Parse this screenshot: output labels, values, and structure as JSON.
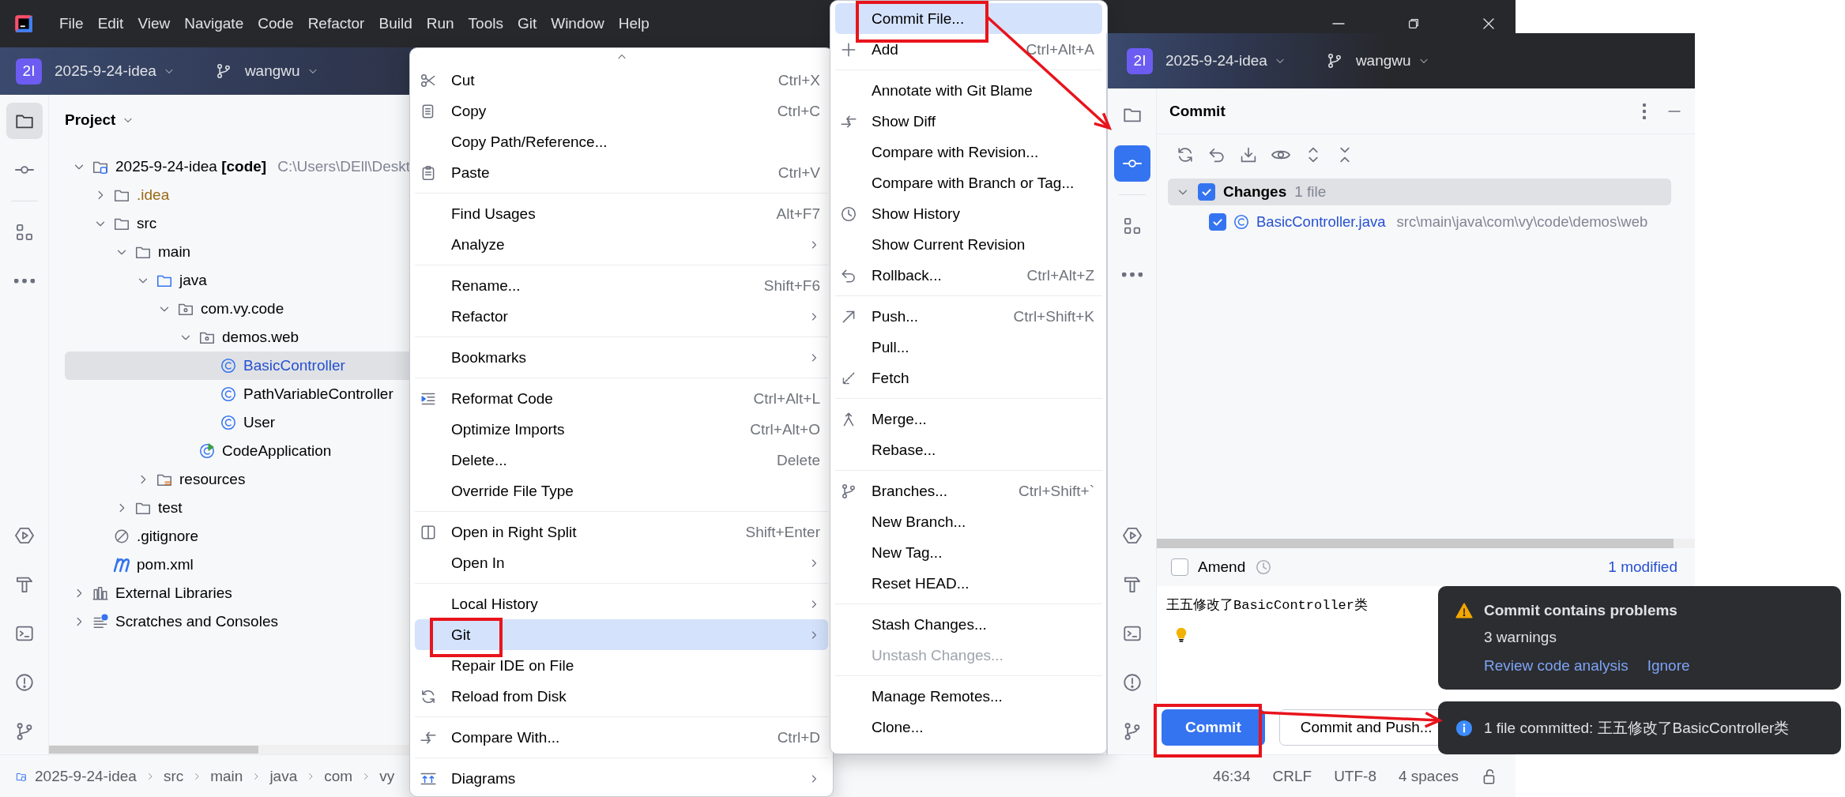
{
  "title_bar": {
    "menu": [
      "File",
      "Edit",
      "View",
      "Navigate",
      "Code",
      "Refactor",
      "Build",
      "Run",
      "Tools",
      "Git",
      "Window",
      "Help"
    ]
  },
  "toolbar": {
    "project_initials": "2I",
    "project": "2025-9-24-idea",
    "branch": "wangwu"
  },
  "left_stripe": {
    "top": [
      {
        "selected": true
      },
      {
        "selected": false
      },
      {
        "selected": false
      },
      {
        "selected": false
      }
    ],
    "bottom": [
      {
        "selected": false
      },
      {
        "selected": false
      },
      {
        "selected": false
      },
      {
        "selected": false
      },
      {
        "selected": false
      }
    ]
  },
  "project_panel": {
    "title": "Project",
    "tree": [
      {
        "label": "2025-9-24-idea **[code]**",
        "hint": "C:\\Users\\DEll\\Deskt",
        "kind": "module",
        "expanded": true,
        "selected": false,
        "children": [
          {
            "label": ".idea",
            "kind": "folder",
            "expanded": false,
            "selected": false,
            "color": "#9a6a14"
          },
          {
            "label": "src",
            "kind": "folder",
            "expanded": true,
            "selected": false,
            "children": [
              {
                "label": "main",
                "kind": "folder",
                "expanded": true,
                "selected": false,
                "children": [
                  {
                    "label": "java",
                    "kind": "source-folder",
                    "expanded": true,
                    "selected": false,
                    "children": [
                      {
                        "label": "com.vy.code",
                        "kind": "package",
                        "expanded": true,
                        "selected": false,
                        "children": [
                          {
                            "label": "demos.web",
                            "kind": "package",
                            "expanded": true,
                            "selected": false,
                            "children": [
                              {
                                "label": "BasicController",
                                "kind": "class",
                                "selected": true,
                                "color": "#2550d0"
                              },
                              {
                                "label": "PathVariableController",
                                "kind": "class",
                                "selected": false
                              },
                              {
                                "label": "User",
                                "kind": "class",
                                "selected": false
                              }
                            ]
                          },
                          {
                            "label": "CodeApplication",
                            "kind": "app-class",
                            "selected": false
                          }
                        ]
                      }
                    ]
                  },
                  {
                    "label": "resources",
                    "kind": "resources-folder",
                    "expanded": false,
                    "selected": false
                  }
                ]
              },
              {
                "label": "test",
                "kind": "folder",
                "expanded": false,
                "selected": false
              }
            ]
          },
          {
            "label": ".gitignore",
            "kind": "ignore-file",
            "selected": false
          },
          {
            "label": "pom.xml",
            "kind": "maven-file",
            "selected": false
          }
        ]
      },
      {
        "label": "External Libraries",
        "kind": "libraries",
        "expanded": false,
        "selected": false
      },
      {
        "label": "Scratches and Consoles",
        "kind": "scratches",
        "expanded": false,
        "selected": false
      }
    ]
  },
  "status_bar": {
    "breadcrumbs": [
      "2025-9-24-idea",
      "src",
      "main",
      "java",
      "com",
      "vy"
    ],
    "caret": "46:34",
    "line_separator": "CRLF",
    "encoding": "UTF-8",
    "indent": "4 spaces"
  },
  "context_menu": {
    "sections": [
      [
        {
          "label": "Cut",
          "shortcut": "Ctrl+X",
          "selected": false
        },
        {
          "label": "Copy",
          "shortcut": "Ctrl+C",
          "selected": false
        },
        {
          "label": "Copy Path/Reference...",
          "selected": false
        },
        {
          "label": "Paste",
          "shortcut": "Ctrl+V",
          "selected": false
        }
      ],
      [
        {
          "label": "Find Usages",
          "shortcut": "Alt+F7",
          "selected": false
        },
        {
          "label": "Analyze",
          "submenu": true,
          "selected": false
        }
      ],
      [
        {
          "label": "Rename...",
          "shortcut": "Shift+F6",
          "selected": false
        },
        {
          "label": "Refactor",
          "submenu": true,
          "selected": false
        }
      ],
      [
        {
          "label": "Bookmarks",
          "submenu": true,
          "selected": false
        }
      ],
      [
        {
          "label": "Reformat Code",
          "shortcut": "Ctrl+Alt+L",
          "selected": false
        },
        {
          "label": "Optimize Imports",
          "shortcut": "Ctrl+Alt+O",
          "selected": false
        },
        {
          "label": "Delete...",
          "shortcut": "Delete",
          "selected": false
        },
        {
          "label": "Override File Type",
          "selected": false
        }
      ],
      [
        {
          "label": "Open in Right Split",
          "shortcut": "Shift+Enter",
          "selected": false
        },
        {
          "label": "Open In",
          "submenu": true,
          "selected": false
        }
      ],
      [
        {
          "label": "Local History",
          "submenu": true,
          "selected": false
        },
        {
          "label": "Git",
          "submenu": true,
          "selected": true
        },
        {
          "label": "Repair IDE on File",
          "selected": false
        },
        {
          "label": "Reload from Disk",
          "selected": false
        }
      ],
      [
        {
          "label": "Compare With...",
          "shortcut": "Ctrl+D",
          "selected": false
        }
      ],
      [
        {
          "label": "Diagrams",
          "submenu": true,
          "selected": false
        }
      ]
    ]
  },
  "git_menu": {
    "sections": [
      [
        {
          "label": "Commit File...",
          "selected": true
        },
        {
          "label": "Add",
          "shortcut": "Ctrl+Alt+A",
          "selected": false
        }
      ],
      [
        {
          "label": "Annotate with Git Blame",
          "selected": false
        },
        {
          "label": "Show Diff",
          "selected": false
        },
        {
          "label": "Compare with Revision...",
          "selected": false
        },
        {
          "label": "Compare with Branch or Tag...",
          "selected": false
        },
        {
          "label": "Show History",
          "selected": false
        },
        {
          "label": "Show Current Revision",
          "selected": false
        },
        {
          "label": "Rollback...",
          "shortcut": "Ctrl+Alt+Z",
          "selected": false
        }
      ],
      [
        {
          "label": "Push...",
          "shortcut": "Ctrl+Shift+K",
          "selected": false
        },
        {
          "label": "Pull...",
          "selected": false
        },
        {
          "label": "Fetch",
          "selected": false
        }
      ],
      [
        {
          "label": "Merge...",
          "selected": false
        },
        {
          "label": "Rebase...",
          "selected": false
        }
      ],
      [
        {
          "label": "Branches...",
          "shortcut": "Ctrl+Shift+`",
          "selected": false
        },
        {
          "label": "New Branch...",
          "selected": false
        },
        {
          "label": "New Tag...",
          "selected": false
        },
        {
          "label": "Reset HEAD...",
          "selected": false
        }
      ],
      [
        {
          "label": "Stash Changes...",
          "selected": false
        },
        {
          "label": "Unstash Changes...",
          "disabled": true,
          "selected": false
        }
      ],
      [
        {
          "label": "Manage Remotes...",
          "selected": false
        },
        {
          "label": "Clone...",
          "selected": false
        }
      ]
    ]
  },
  "commit_panel": {
    "toolbar": {
      "project_initials": "2I",
      "project": "2025-9-24-idea",
      "branch": "wangwu"
    },
    "left_stripe": {
      "top": [
        {
          "selected": false
        },
        {
          "selected": true
        },
        {
          "selected": false
        },
        {
          "selected": false
        }
      ],
      "bottom": [
        {
          "selected": false
        },
        {
          "selected": false
        },
        {
          "selected": false
        },
        {
          "selected": false
        },
        {
          "selected": false
        }
      ]
    },
    "title": "Commit",
    "changes": {
      "label": "Changes",
      "count": "1 file",
      "checked": true,
      "expanded": true,
      "files": [
        {
          "name": "BasicController.java",
          "path": "src\\main\\java\\com\\vy\\code\\demos\\web",
          "checked": true
        }
      ]
    },
    "amend": {
      "label": "Amend",
      "checked": false
    },
    "modified": "1 modified",
    "message": "王五修改了BasicController类",
    "buttons": [
      {
        "label": "Commit",
        "primary": true
      },
      {
        "label": "Commit and Push...",
        "primary": false
      }
    ]
  },
  "notifications": [
    {
      "kind": "warning",
      "title": "Commit contains problems",
      "body": "3 warnings",
      "actions": [
        "Review code analysis",
        "Ignore"
      ]
    },
    {
      "kind": "info",
      "body": "1 file committed: 王五修改了BasicController类"
    }
  ]
}
